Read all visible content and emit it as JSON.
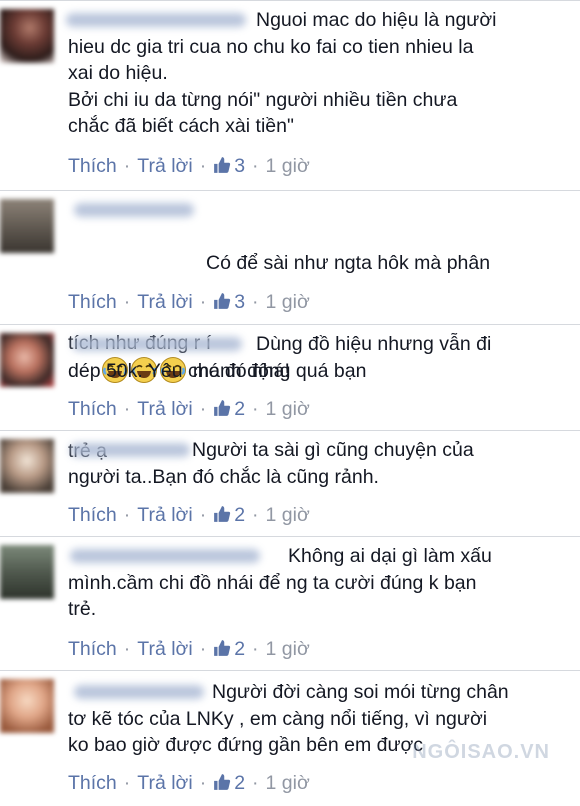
{
  "comments": [
    {
      "text": "Nguoi mac do hiệu là người\nhieu dc gia tri cua no chu ko fai co tien nhieu la\nxai do hiệu.\nBởi chi iu da từng nói\" người nhiều tiền chưa\nchắc đã biết cách xài tiền\"",
      "like_label": "Thích",
      "reply_label": "Trả lời",
      "likes": "3",
      "time": "1 giờ"
    },
    {
      "text_line1": "Có để sài như ngta hôk mà phân",
      "text_line2_pre": "tích như đúng r í",
      "text_line2_post": " manh động quá bạn",
      "text_line3": "trẻ ạ",
      "emoji_icon": "laughing-tears-emoji",
      "like_label": "Thích",
      "reply_label": "Trả lời",
      "likes": "3",
      "time": "1 giờ"
    },
    {
      "text": "Dùng đồ hiệu nhưng vẫn đi\ndép 50k. Yêu chó đó nhá!",
      "like_label": "Thích",
      "reply_label": "Trả lời",
      "likes": "2",
      "time": "1 giờ"
    },
    {
      "text": "Người ta sài gì cũng chuyện của\nngười ta..Bạn đó chắc là cũng rảnh.",
      "like_label": "Thích",
      "reply_label": "Trả lời",
      "likes": "2",
      "time": "1 giờ"
    },
    {
      "text": "Không ai dại gì làm xấu\nmình.cầm chi đồ nhái để ng ta cười đúng k bạn\ntrẻ.",
      "like_label": "Thích",
      "reply_label": "Trả lời",
      "likes": "2",
      "time": "1 giờ"
    },
    {
      "text": "Người đời càng soi mói từng chân\ntơ kẽ tóc của LNKy , em càng nổi tiếng, vì người\nko bao giờ được đứng gần bên em được",
      "like_label": "Thích",
      "reply_label": "Trả lời",
      "likes": "2",
      "time": "1 giờ"
    }
  ],
  "watermark": "NGÔISAO.VN",
  "colors": {
    "link": "#5b74a8",
    "text": "#141823",
    "meta": "#9197a3",
    "divider": "#d6d9de"
  }
}
